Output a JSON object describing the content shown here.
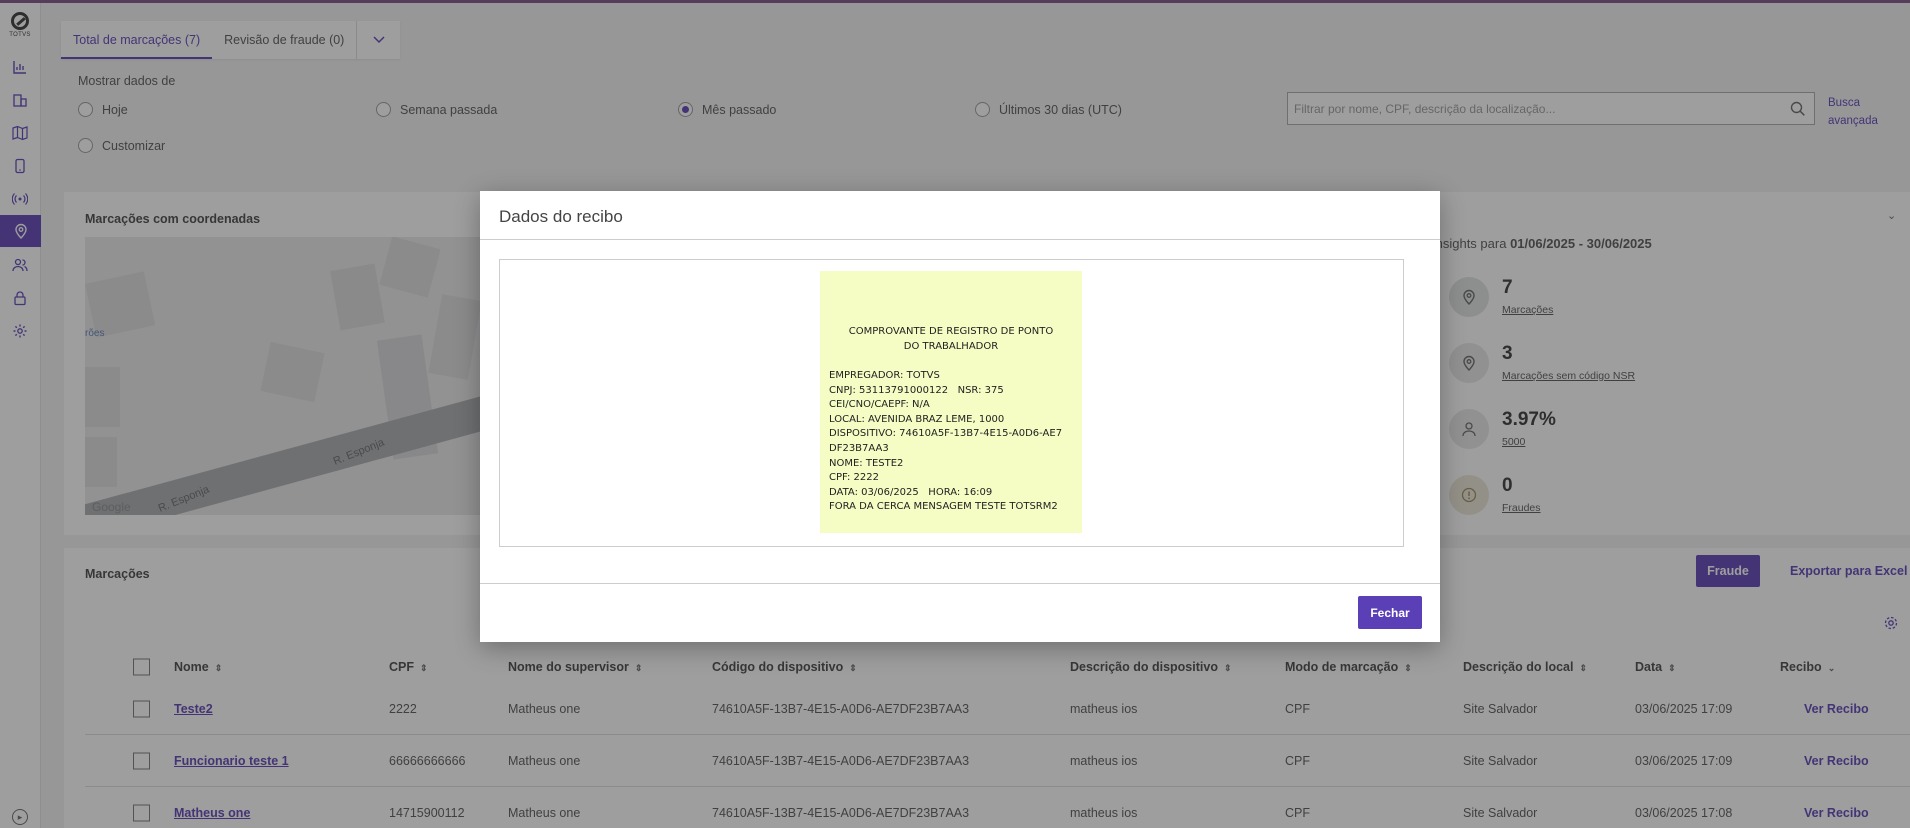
{
  "logo": {
    "text": "TOTVS"
  },
  "tabs": [
    {
      "label": "Total de marcações (7)"
    },
    {
      "label": "Revisão de fraude (0)"
    }
  ],
  "filters": {
    "label": "Mostrar dados de",
    "options": [
      "Hoje",
      "Semana passada",
      "Mês passado",
      "Últimos 30 dias (UTC)",
      "Customizar"
    ],
    "selected": "Mês passado"
  },
  "search": {
    "placeholder": "Filtrar por nome, CPF, descrição da localização..."
  },
  "advanced_search": "Busca avançada",
  "map_panel": {
    "title": "Marcações com coordenadas",
    "street_1": "R. Esponja",
    "street_2": "R. Esponja",
    "partial_label": "rões",
    "google": "Google"
  },
  "insights": {
    "prefix": "Insights para",
    "range": "01/06/2025 - 30/06/2025",
    "items": [
      {
        "value": "7",
        "label": "Marcações",
        "icon": "location-pin-icon"
      },
      {
        "value": "3",
        "label": "Marcações sem código NSR",
        "icon": "location-pin-icon"
      },
      {
        "value": "3.97%",
        "label": "5000",
        "icon": "person-icon"
      },
      {
        "value": "0",
        "label": "Fraudes",
        "icon": "alert-icon"
      }
    ]
  },
  "markings": {
    "title": "Marcações",
    "fraud_button": "Fraude",
    "export_button": "Exportar para Excel",
    "columns": [
      "Nome",
      "CPF",
      "Nome do supervisor",
      "Código do dispositivo",
      "Descrição do dispositivo",
      "Modo de marcação",
      "Descrição do local",
      "Data",
      "Recibo"
    ],
    "rows": [
      {
        "nome": "Teste2",
        "cpf": "2222",
        "supervisor": "Matheus one",
        "codigo": "74610A5F-13B7-4E15-A0D6-AE7DF23B7AA3",
        "descricao": "matheus ios",
        "modo": "CPF",
        "local": "Site Salvador",
        "data": "03/06/2025 17:09",
        "recibo": "Ver Recibo"
      },
      {
        "nome": "Funcionario teste 1",
        "cpf": "66666666666",
        "supervisor": "Matheus one",
        "codigo": "74610A5F-13B7-4E15-A0D6-AE7DF23B7AA3",
        "descricao": "matheus ios",
        "modo": "CPF",
        "local": "Site Salvador",
        "data": "03/06/2025 17:09",
        "recibo": "Ver Recibo"
      },
      {
        "nome": "Matheus one",
        "cpf": "14715900112",
        "supervisor": "Matheus one",
        "codigo": "74610A5F-13B7-4E15-A0D6-AE7DF23B7AA3",
        "descricao": "matheus ios",
        "modo": "CPF",
        "local": "Site Salvador",
        "data": "03/06/2025 17:08",
        "recibo": "Ver Recibo"
      }
    ]
  },
  "modal": {
    "title": "Dados do recibo",
    "close_button": "Fechar",
    "receipt": {
      "title_line1": "COMPROVANTE DE REGISTRO DE PONTO",
      "title_line2": "DO TRABALHADOR",
      "lines": [
        "EMPREGADOR: TOTVS",
        "CNPJ: 53113791000122   NSR: 375",
        "CEI/CNO/CAEPF: N/A",
        "LOCAL: AVENIDA BRAZ LEME, 1000",
        "DISPOSITIVO: 74610A5F-13B7-4E15-A0D6-AE7",
        "DF23B7AA3",
        "NOME: TESTE2",
        "CPF: 2222",
        "DATA: 03/06/2025   HORA: 16:09",
        "FORA DA CERCA MENSAGEM TESTE TOTSRM2"
      ],
      "background": "#f5fdc4"
    }
  },
  "colors": {
    "accent": "#5b3fb6",
    "topline": "#7a4f86"
  }
}
